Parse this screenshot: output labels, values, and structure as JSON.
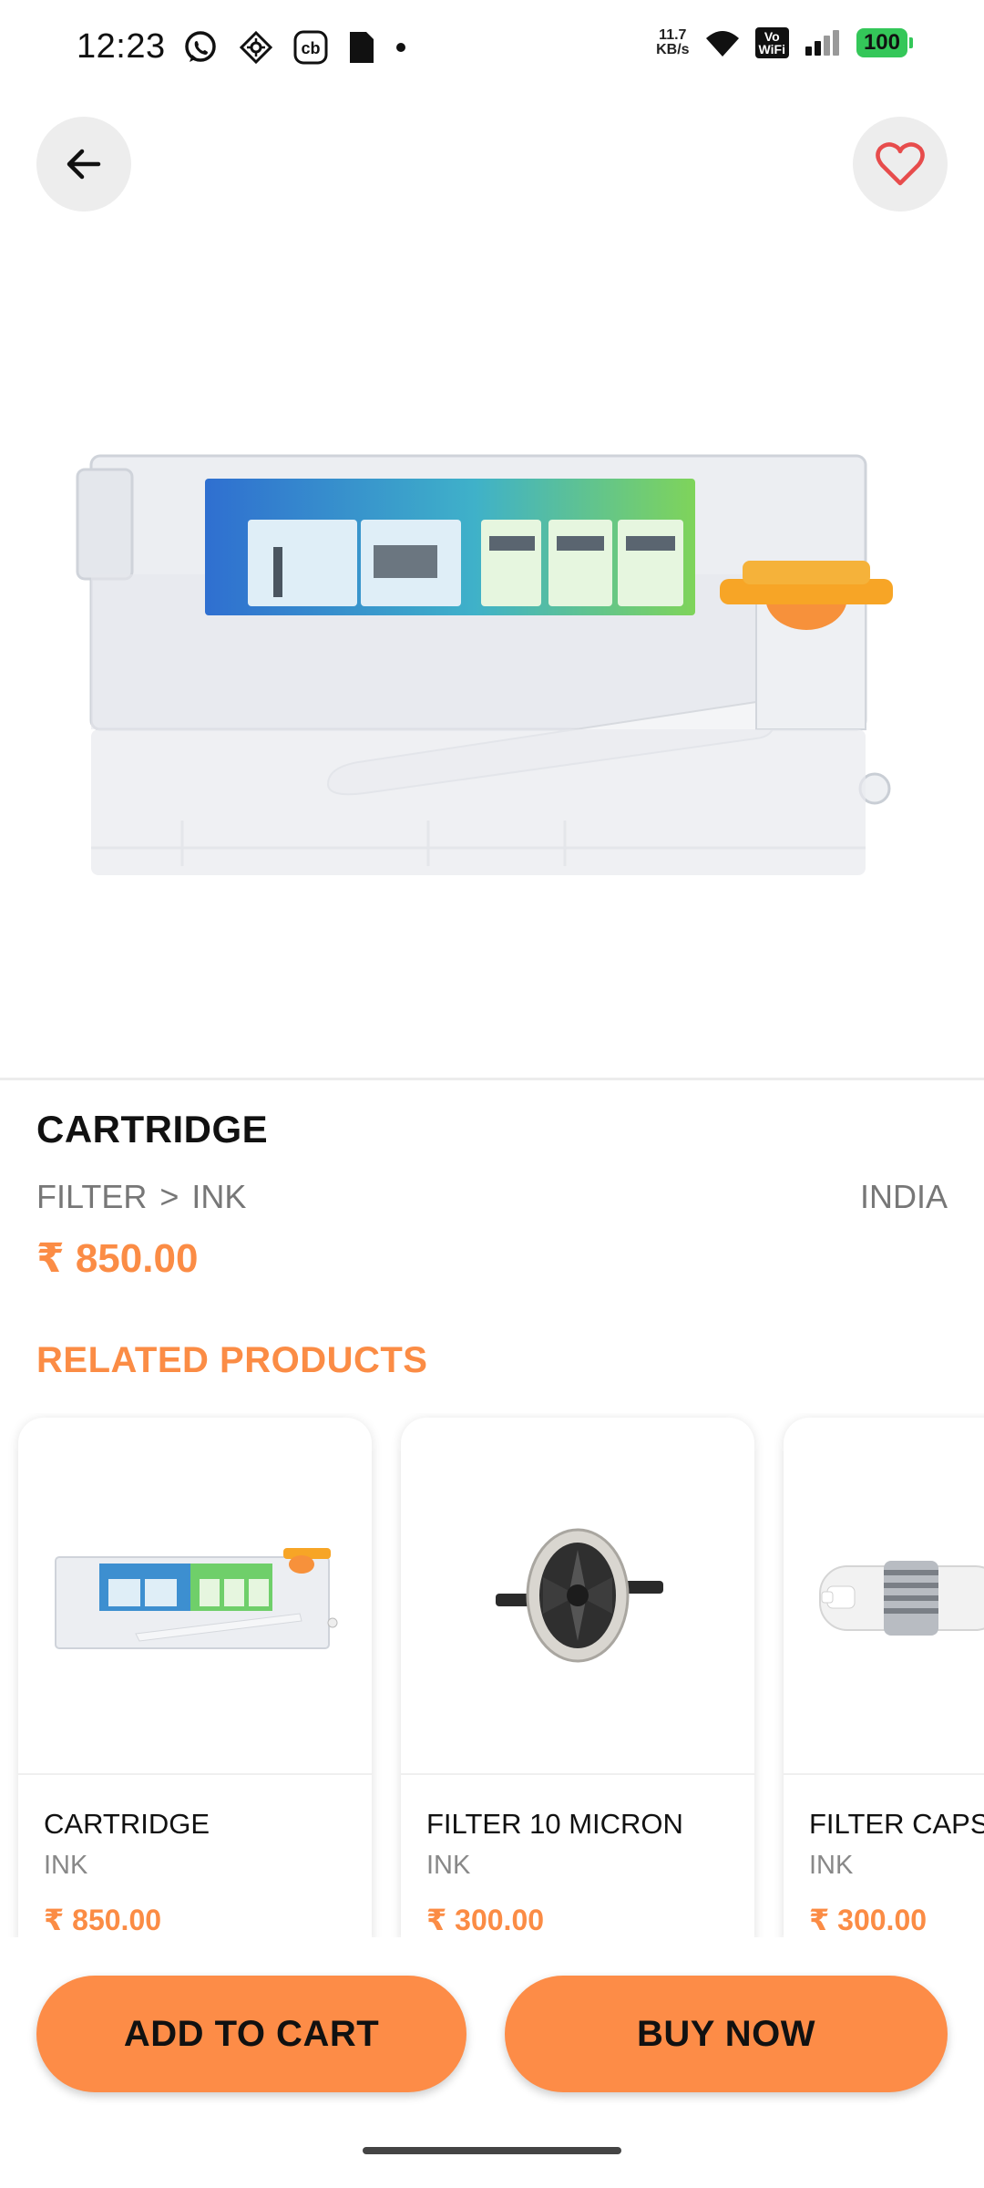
{
  "status_bar": {
    "time": "12:23",
    "net_speed_value": "11.7",
    "net_speed_unit": "KB/s",
    "vowifi_top": "Vo",
    "vowifi_bottom": "WiFi",
    "battery": "100",
    "left_icons": [
      "whatsapp-icon",
      "gps-icon",
      "cb-icon",
      "sim-icon",
      "dot-icon"
    ],
    "right_icons": [
      "wifi-icon",
      "signal-icon"
    ]
  },
  "header": {
    "back_icon": "arrow-left-icon",
    "favorite_icon": "heart-icon"
  },
  "product": {
    "title": "CARTRIDGE",
    "category": "FILTER",
    "separator": ">",
    "subcategory": "INK",
    "origin": "INDIA",
    "price": "₹ 850.00"
  },
  "related": {
    "title": "RELATED PRODUCTS",
    "items": [
      {
        "name": "CARTRIDGE",
        "category": "INK",
        "price": "₹ 850.00"
      },
      {
        "name": "FILTER 10 MICRON",
        "category": "INK",
        "price": "₹ 300.00"
      },
      {
        "name": "FILTER CAPSULE",
        "category": "INK",
        "price": "₹ 300.00"
      }
    ]
  },
  "actions": {
    "add_to_cart": "ADD TO CART",
    "buy_now": "BUY NOW"
  },
  "colors": {
    "accent": "#fb8c45",
    "button": "#fd8c47",
    "battery": "#34c759"
  }
}
